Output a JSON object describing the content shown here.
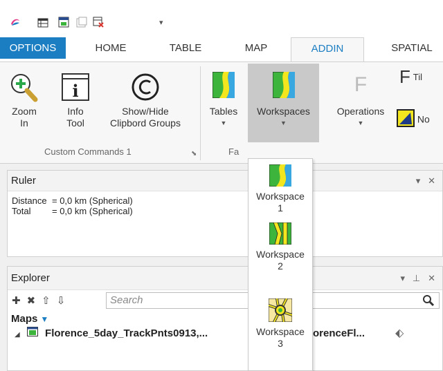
{
  "tabs": [
    {
      "label": "OPTIONS"
    },
    {
      "label": "HOME"
    },
    {
      "label": "TABLE"
    },
    {
      "label": "MAP"
    },
    {
      "label": "ADDIN"
    },
    {
      "label": "SPATIAL"
    }
  ],
  "ribbon": {
    "zoom_in": {
      "line1": "Zoom",
      "line2": "In"
    },
    "info_tool": {
      "line1": "Info",
      "line2": "Tool"
    },
    "show_hide": {
      "line1": "Show/Hide",
      "line2": "Clipbord Groups"
    },
    "group1_label": "Custom Commands 1",
    "tables": {
      "label": "Tables"
    },
    "workspaces": {
      "label": "Workspaces"
    },
    "group2_label_partial": "Fa",
    "operations": {
      "label": "Operations"
    },
    "tile_partial": "Til",
    "n_partial": "No"
  },
  "ruler": {
    "title": "Ruler",
    "rows": [
      {
        "key": "Distance",
        "value": "= 0,0 km (Spherical)"
      },
      {
        "key": "Total",
        "value": "= 0,0 km (Spherical)"
      }
    ]
  },
  "explorer": {
    "title": "Explorer",
    "search_placeholder": "Search",
    "maps_label": "Maps",
    "tree_item_left": "Florence_5day_TrackPnts0913,...",
    "tree_item_right": "orenceFl..."
  },
  "dropdown": {
    "items": [
      {
        "line1": "Workspace",
        "line2": "1"
      },
      {
        "line1": "Workspace",
        "line2": "2"
      },
      {
        "line1": "Workspace",
        "line2": "3"
      }
    ]
  },
  "colors": {
    "accent": "#1c7ec2",
    "map_green": "#3db53d",
    "map_yellow": "#f3e51e",
    "map_blue": "#3aa8e0"
  }
}
